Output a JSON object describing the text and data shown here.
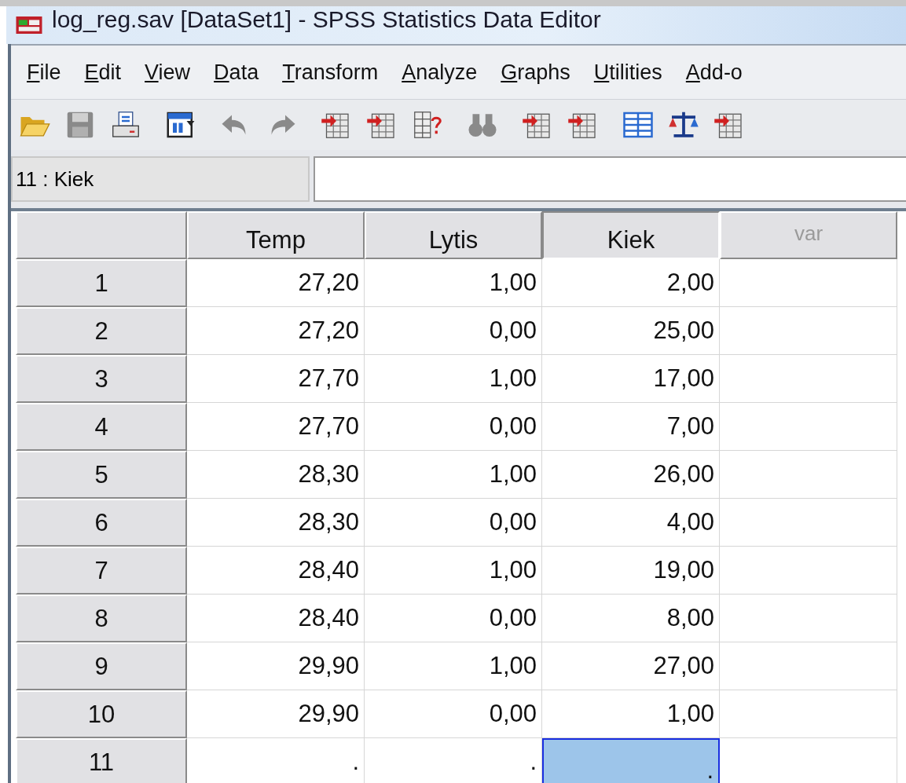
{
  "window": {
    "title": "log_reg.sav [DataSet1] - SPSS Statistics Data Editor"
  },
  "menu": [
    "File",
    "Edit",
    "View",
    "Data",
    "Transform",
    "Analyze",
    "Graphs",
    "Utilities",
    "Add-o"
  ],
  "toolbar": [
    [
      {
        "kind": "open",
        "disabled": false
      },
      {
        "kind": "save",
        "disabled": true
      },
      {
        "kind": "print",
        "disabled": false
      }
    ],
    [
      {
        "kind": "dialog",
        "disabled": false
      }
    ],
    [
      {
        "kind": "undo",
        "disabled": true
      },
      {
        "kind": "redo",
        "disabled": true
      }
    ],
    [
      {
        "kind": "goto-case",
        "disabled": false
      },
      {
        "kind": "goto-variable",
        "disabled": false
      },
      {
        "kind": "variables",
        "disabled": false
      }
    ],
    [
      {
        "kind": "find",
        "disabled": true
      }
    ],
    [
      {
        "kind": "insert-variable",
        "disabled": false
      },
      {
        "kind": "insert-case",
        "disabled": false
      }
    ],
    [
      {
        "kind": "split",
        "disabled": false
      },
      {
        "kind": "weight",
        "disabled": false
      },
      {
        "kind": "select",
        "disabled": false
      }
    ]
  ],
  "cell_editor": {
    "reference": "11 : Kiek"
  },
  "table": {
    "columns": [
      {
        "label": "Temp",
        "defined": true,
        "selected": false
      },
      {
        "label": "Lytis",
        "defined": true,
        "selected": false
      },
      {
        "label": "Kiek",
        "defined": true,
        "selected": true
      },
      {
        "label": "var",
        "defined": false,
        "selected": false
      }
    ],
    "rows": [
      {
        "label": "1",
        "cells": [
          {
            "value": "27,20",
            "selected": false
          },
          {
            "value": "1,00",
            "selected": false
          },
          {
            "value": "2,00",
            "selected": false
          }
        ]
      },
      {
        "label": "2",
        "cells": [
          {
            "value": "27,20",
            "selected": false
          },
          {
            "value": "0,00",
            "selected": false
          },
          {
            "value": "25,00",
            "selected": false
          }
        ]
      },
      {
        "label": "3",
        "cells": [
          {
            "value": "27,70",
            "selected": false
          },
          {
            "value": "1,00",
            "selected": false
          },
          {
            "value": "17,00",
            "selected": false
          }
        ]
      },
      {
        "label": "4",
        "cells": [
          {
            "value": "27,70",
            "selected": false
          },
          {
            "value": "0,00",
            "selected": false
          },
          {
            "value": "7,00",
            "selected": false
          }
        ]
      },
      {
        "label": "5",
        "cells": [
          {
            "value": "28,30",
            "selected": false
          },
          {
            "value": "1,00",
            "selected": false
          },
          {
            "value": "26,00",
            "selected": false
          }
        ]
      },
      {
        "label": "6",
        "cells": [
          {
            "value": "28,30",
            "selected": false
          },
          {
            "value": "0,00",
            "selected": false
          },
          {
            "value": "4,00",
            "selected": false
          }
        ]
      },
      {
        "label": "7",
        "cells": [
          {
            "value": "28,40",
            "selected": false
          },
          {
            "value": "1,00",
            "selected": false
          },
          {
            "value": "19,00",
            "selected": false
          }
        ]
      },
      {
        "label": "8",
        "cells": [
          {
            "value": "28,40",
            "selected": false
          },
          {
            "value": "0,00",
            "selected": false
          },
          {
            "value": "8,00",
            "selected": false
          }
        ]
      },
      {
        "label": "9",
        "cells": [
          {
            "value": "29,90",
            "selected": false
          },
          {
            "value": "1,00",
            "selected": false
          },
          {
            "value": "27,00",
            "selected": false
          }
        ]
      },
      {
        "label": "10",
        "cells": [
          {
            "value": "29,90",
            "selected": false
          },
          {
            "value": "0,00",
            "selected": false
          },
          {
            "value": "1,00",
            "selected": false
          }
        ]
      },
      {
        "label": "11",
        "cells": [
          {
            "value": ".",
            "selected": false
          },
          {
            "value": ".",
            "selected": false
          },
          {
            "value": ".",
            "selected": true
          }
        ]
      }
    ]
  }
}
